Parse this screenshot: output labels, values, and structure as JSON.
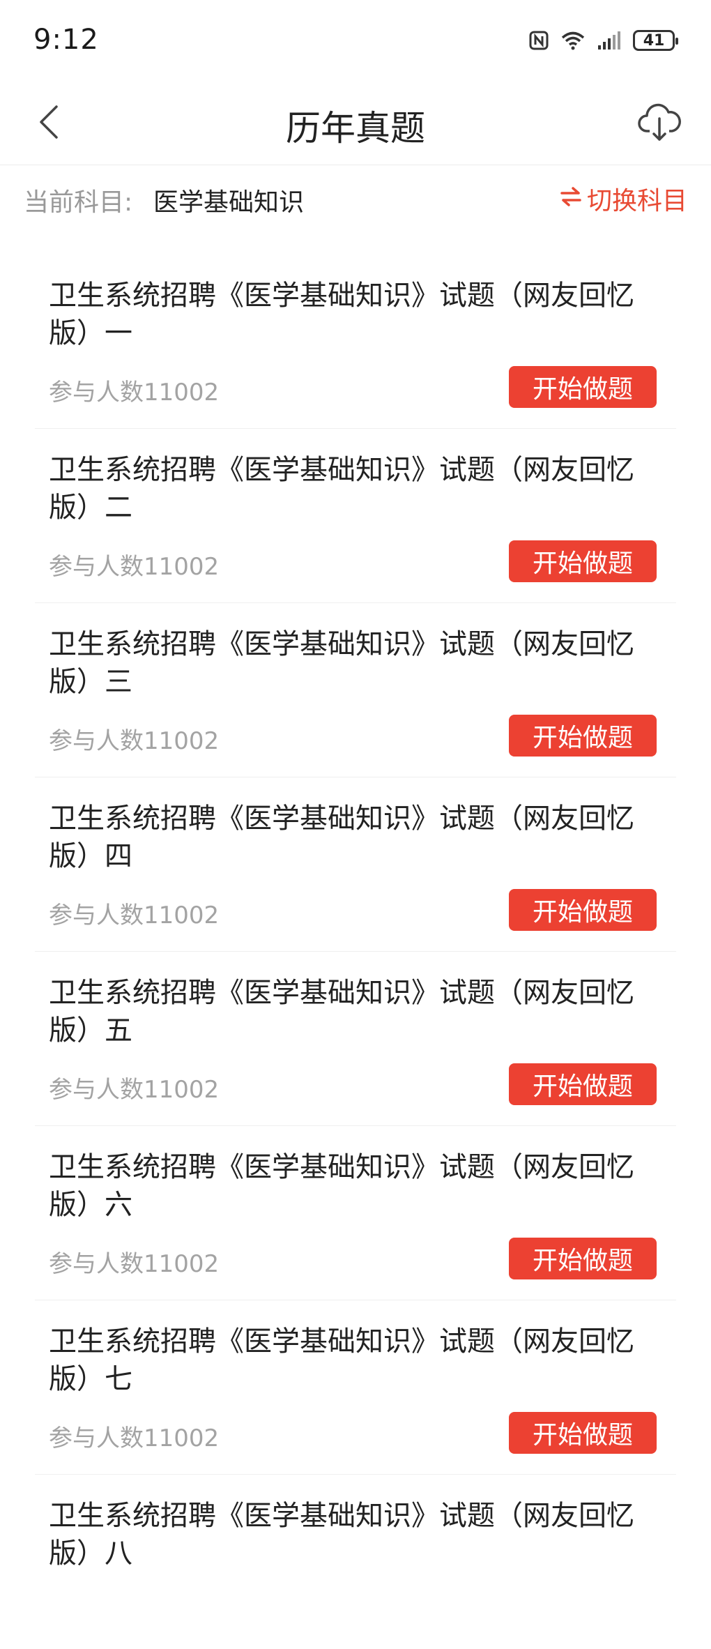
{
  "status_bar": {
    "time": "9:12",
    "battery": "41",
    "icons": [
      "nfc-icon",
      "wifi-icon",
      "signal-icon",
      "battery-icon"
    ]
  },
  "header": {
    "title": "历年真题",
    "back_icon": "chevron-left-icon",
    "download_icon": "cloud-download-icon"
  },
  "subject": {
    "label": "当前科目:",
    "value": "医学基础知识",
    "switch_label": "切换科目",
    "switch_icon": "swap-arrows-icon",
    "accent": "#e84a33"
  },
  "list": {
    "button_color": "#ec4132",
    "items": [
      {
        "title": "卫生系统招聘《医学基础知识》试题（网友回忆版）一",
        "count": "参与人数11002",
        "button": "开始做题"
      },
      {
        "title": "卫生系统招聘《医学基础知识》试题（网友回忆版）二",
        "count": "参与人数11002",
        "button": "开始做题"
      },
      {
        "title": "卫生系统招聘《医学基础知识》试题（网友回忆版）三",
        "count": "参与人数11002",
        "button": "开始做题"
      },
      {
        "title": "卫生系统招聘《医学基础知识》试题（网友回忆版）四",
        "count": "参与人数11002",
        "button": "开始做题"
      },
      {
        "title": "卫生系统招聘《医学基础知识》试题（网友回忆版）五",
        "count": "参与人数11002",
        "button": "开始做题"
      },
      {
        "title": "卫生系统招聘《医学基础知识》试题（网友回忆版）六",
        "count": "参与人数11002",
        "button": "开始做题"
      },
      {
        "title": "卫生系统招聘《医学基础知识》试题（网友回忆版）七",
        "count": "参与人数11002",
        "button": "开始做题"
      },
      {
        "title": "卫生系统招聘《医学基础知识》试题（网友回忆版）八",
        "count": "",
        "button": ""
      }
    ]
  }
}
